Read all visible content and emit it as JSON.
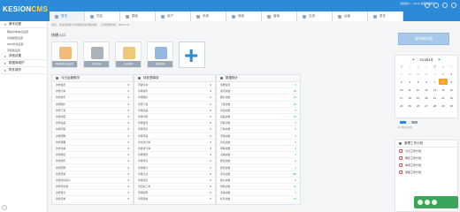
{
  "brand": {
    "part1": "KESION",
    "part2": "CMS"
  },
  "user": {
    "info": "当前用户：admin 超级管理员"
  },
  "tabs": [
    {
      "label": "首页",
      "icon": "home-icon"
    },
    {
      "label": "内容",
      "icon": "document-icon"
    },
    {
      "label": "模板",
      "icon": "template-icon"
    },
    {
      "label": "用户",
      "icon": "user-icon"
    },
    {
      "label": "系统",
      "icon": "gear-icon"
    },
    {
      "label": "商城",
      "icon": "cart-icon"
    },
    {
      "label": "营销",
      "icon": "tag-icon"
    },
    {
      "label": "应用",
      "icon": "app-icon"
    },
    {
      "label": "运营",
      "icon": "chart-icon"
    },
    {
      "label": "更多",
      "icon": "more-icon"
    }
  ],
  "sidebar": {
    "sections": [
      {
        "label": "基本设置",
        "open": true,
        "items": [
          "网站基本信息设置",
          "系统模型设置",
          "SEO优化设置",
          "手机版设置"
        ]
      },
      {
        "label": "其他设置",
        "open": false,
        "items": []
      },
      {
        "label": "数据库维护",
        "open": false,
        "items": []
      },
      {
        "label": "附件操作",
        "open": false,
        "items": []
      }
    ]
  },
  "breadcrumb": "您好，欢迎使用科汛智能建站管理系统！ 上次登录时间：2016-4-8",
  "quick": {
    "title": "快捷入口",
    "tiles": [
      "网站基本信息设置",
      "发布文章",
      "会员管理",
      "模板管理"
    ]
  },
  "panels": [
    {
      "title": "今日运营概况",
      "rows": [
        {
          "l": "新增会员",
          "v": "0",
          "c": "dark"
        },
        {
          "l": "新增订单",
          "v": "0",
          "c": "dark"
        },
        {
          "l": "新增资讯",
          "v": "0",
          "c": "dark"
        },
        {
          "l": "新增图片",
          "v": "0",
          "c": "dark"
        },
        {
          "l": "新增下载",
          "v": "0",
          "c": "dark"
        },
        {
          "l": "新增动漫",
          "v": "0",
          "c": "dark"
        },
        {
          "l": "新增商品",
          "v": "0",
          "c": "dark"
        },
        {
          "l": "新增问答",
          "v": "0",
          "c": "dark"
        },
        {
          "l": "新增团购",
          "v": "0",
          "c": "dark"
        },
        {
          "l": "新增课程",
          "v": "0",
          "c": "dark"
        },
        {
          "l": "新增直播",
          "v": "0",
          "c": "dark"
        },
        {
          "l": "新增职位",
          "v": "0",
          "c": "dark"
        },
        {
          "l": "新增简历",
          "v": "0",
          "c": "dark"
        },
        {
          "l": "新增招聘",
          "v": "0",
          "c": "dark"
        },
        {
          "l": "新增专题",
          "v": "0",
          "c": "dark"
        },
        {
          "l": "新增论坛帖子",
          "v": "0",
          "c": "dark"
        },
        {
          "l": "新增评论数",
          "v": "0",
          "c": "dark"
        },
        {
          "l": "新增留言",
          "v": "0",
          "c": "dark"
        },
        {
          "l": "新增需求",
          "v": "0",
          "c": "dark"
        }
      ]
    },
    {
      "title": "待处理事务",
      "rows": [
        {
          "l": "待审订单",
          "v": "0",
          "c": "dark"
        },
        {
          "l": "待审资讯",
          "v": "0",
          "c": "dark"
        },
        {
          "l": "待审图片",
          "v": "0",
          "c": "dark"
        },
        {
          "l": "待审下载",
          "v": "0",
          "c": "dark"
        },
        {
          "l": "待审商品",
          "v": "0",
          "c": "dark"
        },
        {
          "l": "待审问答",
          "v": "0",
          "c": "dark"
        },
        {
          "l": "待审会员",
          "v": "0",
          "c": "dark"
        },
        {
          "l": "待审评论",
          "v": "0",
          "c": "dark"
        },
        {
          "l": "待审专题",
          "v": "0",
          "c": "dark"
        },
        {
          "l": "待付款订单",
          "v": "0",
          "c": "dark"
        },
        {
          "l": "待发货订单",
          "v": "0",
          "c": "dark"
        },
        {
          "l": "待审简历",
          "v": "0",
          "c": "dark"
        },
        {
          "l": "待审评论",
          "v": "0",
          "c": "dark"
        },
        {
          "l": "待审留言",
          "v": "0",
          "c": "dark"
        },
        {
          "l": "待审企业",
          "v": "0",
          "c": "dark"
        },
        {
          "l": "待审论坛",
          "v": "0",
          "c": "dark"
        },
        {
          "l": "待回复工单",
          "v": "0",
          "c": "dark"
        },
        {
          "l": "待审提现",
          "v": "0",
          "c": "dark"
        },
        {
          "l": "待审需求",
          "v": "0",
          "c": "dark"
        }
      ]
    },
    {
      "title": "数据统计",
      "rows": [
        {
          "l": "注册会员",
          "v": "5",
          "c": "green"
        },
        {
          "l": "资讯总数",
          "v": "46",
          "c": "green"
        },
        {
          "l": "图片总数",
          "v": "21",
          "c": "green"
        },
        {
          "l": "下载总数",
          "v": "19",
          "c": "green"
        },
        {
          "l": "动漫总数",
          "v": "8",
          "c": "green"
        },
        {
          "l": "商品总数",
          "v": "32",
          "c": "green"
        },
        {
          "l": "问答总数",
          "v": "3",
          "c": "green"
        },
        {
          "l": "订单总数",
          "v": "6",
          "c": "green"
        },
        {
          "l": "专题总数",
          "v": "3",
          "c": "green"
        },
        {
          "l": "论坛总数",
          "v": "0",
          "c": "green"
        },
        {
          "l": "课程总数",
          "v": "4",
          "c": "green"
        },
        {
          "l": "直播总数",
          "v": "2",
          "c": "green"
        },
        {
          "l": "职位总数",
          "v": "2",
          "c": "green"
        },
        {
          "l": "简历总数",
          "v": "1",
          "c": "green"
        },
        {
          "l": "评论总数",
          "v": "155",
          "c": "green"
        },
        {
          "l": "留言总数",
          "v": "6",
          "c": "green"
        },
        {
          "l": "附件总数",
          "v": "11",
          "c": "green"
        },
        {
          "l": "需求总数",
          "v": "1",
          "c": "green"
        },
        {
          "l": "标签总数",
          "v": "27",
          "c": "green"
        }
      ]
    }
  ],
  "button": {
    "label": "发布新内容"
  },
  "calendar": {
    "title": "2016年4月",
    "prev": "◀",
    "next": "▶",
    "weekdays": [
      "日",
      "一",
      "二",
      "三",
      "四",
      "五",
      "六"
    ],
    "days": [
      {
        "d": "27",
        "m": true
      },
      {
        "d": "28",
        "m": true
      },
      {
        "d": "29",
        "m": true
      },
      {
        "d": "30",
        "m": true
      },
      {
        "d": "31",
        "m": true
      },
      {
        "d": "1"
      },
      {
        "d": "2"
      },
      {
        "d": "3"
      },
      {
        "d": "4"
      },
      {
        "d": "5"
      },
      {
        "d": "6"
      },
      {
        "d": "7"
      },
      {
        "d": "8",
        "t": true
      },
      {
        "d": "9"
      },
      {
        "d": "10"
      },
      {
        "d": "11"
      },
      {
        "d": "12"
      },
      {
        "d": "13"
      },
      {
        "d": "14"
      },
      {
        "d": "15"
      },
      {
        "d": "16"
      },
      {
        "d": "17"
      },
      {
        "d": "18"
      },
      {
        "d": "19"
      },
      {
        "d": "20"
      },
      {
        "d": "21"
      },
      {
        "d": "22"
      },
      {
        "d": "23"
      },
      {
        "d": "24"
      },
      {
        "d": "25"
      },
      {
        "d": "26"
      },
      {
        "d": "27"
      },
      {
        "d": "28"
      },
      {
        "d": "29"
      },
      {
        "d": "30"
      }
    ]
  },
  "legend": {
    "colors": [
      "#2d8ad8",
      "#9aa8b5"
    ],
    "text": "有计划 无计划"
  },
  "plan": {
    "title": "管理工作计划",
    "items": [
      "今日工作计划",
      "明天工作计划",
      "本周工作计划",
      "添加工作计划"
    ]
  },
  "colors": {
    "accent": "#2d8ad8",
    "green": "#2da34a",
    "today": "#f6a623"
  }
}
